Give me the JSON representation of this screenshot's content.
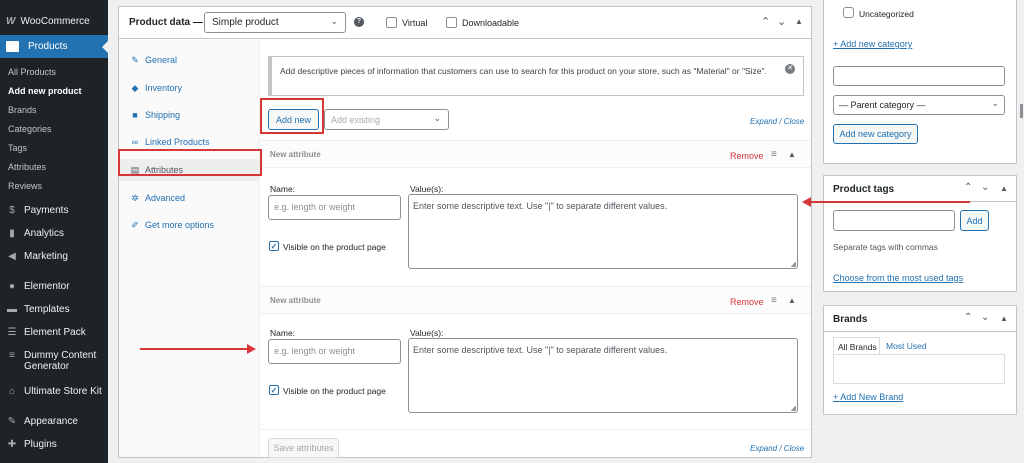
{
  "sidebar": {
    "woocommerce": "WooCommerce",
    "logo": "W",
    "products": "Products",
    "submenu": [
      "All Products",
      "Add new product",
      "Brands",
      "Categories",
      "Tags",
      "Attributes",
      "Reviews"
    ],
    "items": [
      {
        "label": "Payments",
        "icon": "payments-icon"
      },
      {
        "label": "Analytics",
        "icon": "analytics-icon"
      },
      {
        "label": "Marketing",
        "icon": "marketing-icon"
      },
      {
        "label": "Elementor",
        "icon": "elementor-icon"
      },
      {
        "label": "Templates",
        "icon": "templates-icon"
      },
      {
        "label": "Element Pack",
        "icon": "element-pack-icon"
      },
      {
        "label": "Dummy Content Generator",
        "icon": "dummy-content-icon"
      },
      {
        "label": "Ultimate Store Kit",
        "icon": "store-kit-icon"
      },
      {
        "label": "Appearance",
        "icon": "appearance-icon"
      },
      {
        "label": "Plugins",
        "icon": "plugins-icon"
      }
    ]
  },
  "product_data": {
    "title": "Product data —",
    "type_value": "Simple product",
    "virtual_label": "Virtual",
    "downloadable_label": "Downloadable",
    "tabs": [
      {
        "label": "General",
        "icon": "wrench-icon"
      },
      {
        "label": "Inventory",
        "icon": "inventory-icon"
      },
      {
        "label": "Shipping",
        "icon": "truck-icon"
      },
      {
        "label": "Linked Products",
        "icon": "link-icon"
      },
      {
        "label": "Attributes",
        "icon": "table-icon"
      },
      {
        "label": "Advanced",
        "icon": "gear-icon"
      },
      {
        "label": "Get more options",
        "icon": "plugin-icon"
      }
    ],
    "notice": "Add descriptive pieces of information that customers can use to search for this product on your store, such as \"Material\" or \"Size\".",
    "add_new": "Add new",
    "add_existing_placeholder": "Add existing",
    "expand_close": "Expand / Close",
    "attributes": [
      {
        "title": "New attribute",
        "remove": "Remove",
        "name_label": "Name:",
        "name_placeholder": "e.g. length or weight",
        "values_label": "Value(s):",
        "values_placeholder": "Enter some descriptive text. Use \"|\" to separate different values.",
        "visible_label": "Visible on the product page"
      },
      {
        "title": "New attribute",
        "remove": "Remove",
        "name_label": "Name:",
        "name_placeholder": "e.g. length or weight",
        "values_label": "Value(s):",
        "values_placeholder": "Enter some descriptive text. Use \"|\" to separate different values.",
        "visible_label": "Visible on the product page"
      }
    ],
    "save_attributes": "Save attributes"
  },
  "categories": {
    "uncategorized": "Uncategorized",
    "add_new_link": "+ Add new category",
    "parent_placeholder": "— Parent category —",
    "add_button": "Add new category"
  },
  "product_tags": {
    "title": "Product tags",
    "add_button": "Add",
    "hint": "Separate tags with commas",
    "choose_link": "Choose from the most used tags"
  },
  "brands": {
    "title": "Brands",
    "tab_all": "All Brands",
    "tab_most_used": "Most Used",
    "add_link": "+ Add New Brand"
  },
  "colors": {
    "accent": "#2271b1",
    "sidebar": "#1d2327",
    "highlight": "#d63638"
  }
}
